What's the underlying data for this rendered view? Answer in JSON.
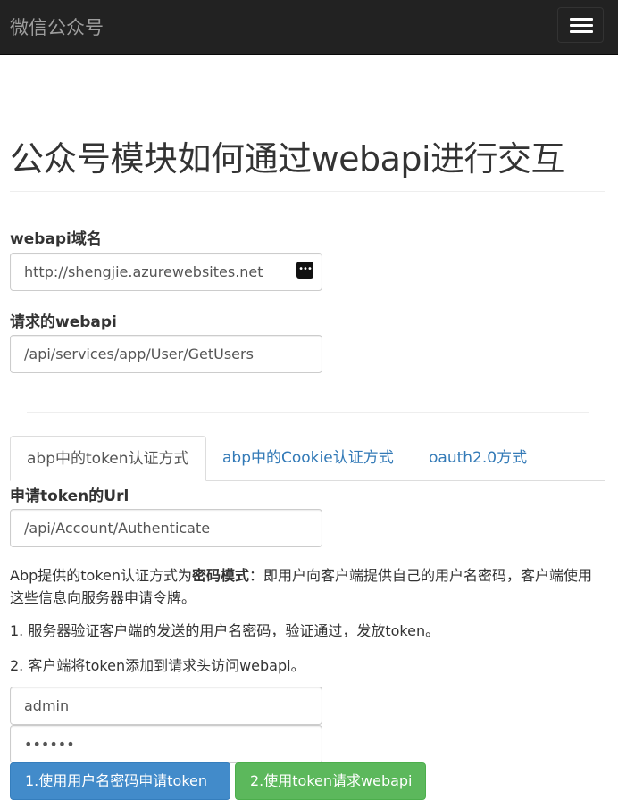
{
  "navbar": {
    "brand": "微信公众号",
    "toggle_icon": "hamburger-icon"
  },
  "page": {
    "title": "公众号模块如何通过webapi进行交互",
    "domain_label": "webapi域名",
    "domain_value": "http://shengjie.azurewebsites.net",
    "request_label": "请求的webapi",
    "request_value": "/api/services/app/User/GetUsers"
  },
  "tabs": [
    {
      "label": "abp中的token认证方式",
      "active": true
    },
    {
      "label": "abp中的Cookie认证方式",
      "active": false
    },
    {
      "label": "oauth2.0方式",
      "active": false
    }
  ],
  "token_panel": {
    "url_label": "申请token的Url",
    "url_value": "/api/Account/Authenticate",
    "desc_prefix": "Abp提供的token认证方式为",
    "desc_bold": "密码模式",
    "desc_suffix": "：即用户向客户端提供自己的用户名密码，客户端使用这些信息向服务器申请令牌。",
    "step1": "1. 服务器验证客户端的发送的用户名密码，验证通过，发放token。",
    "step2": "2. 客户端将token添加到请求头访问webapi。",
    "username_value": "admin",
    "password_value": "••••••",
    "btn_request_token": "1.使用用户名密码申请token",
    "btn_call_api": "2.使用token请求webapi"
  },
  "colors": {
    "primary": "#428bca",
    "success": "#5cb85c",
    "navbar": "#222222",
    "link": "#337ab7"
  }
}
